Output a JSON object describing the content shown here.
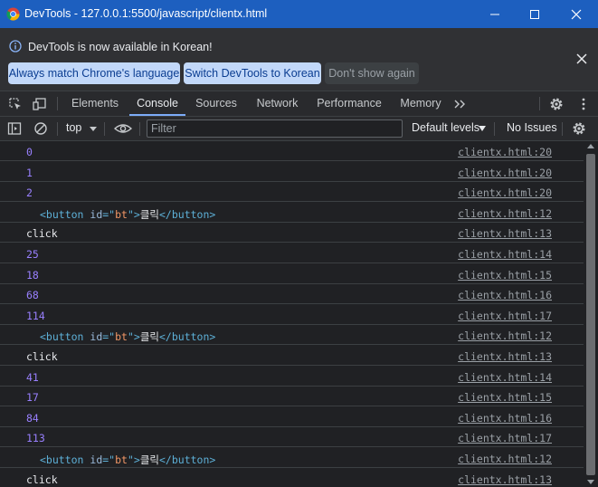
{
  "window": {
    "title": "DevTools - 127.0.0.1:5500/javascript/clientx.html"
  },
  "infobar": {
    "message": "DevTools is now available in Korean!",
    "buttons": [
      "Always match Chrome's language",
      "Switch DevTools to Korean",
      "Don't show again"
    ]
  },
  "tabs": [
    "Elements",
    "Console",
    "Sources",
    "Network",
    "Performance",
    "Memory"
  ],
  "active_tab": "Console",
  "console_toolbar": {
    "context": "top",
    "filter_placeholder": "Filter",
    "levels": "Default levels",
    "issues": "No Issues"
  },
  "logs": [
    {
      "kind": "num",
      "text": "0",
      "source": "clientx.html:20"
    },
    {
      "kind": "num",
      "text": "1",
      "source": "clientx.html:20"
    },
    {
      "kind": "num",
      "text": "2",
      "source": "clientx.html:20"
    },
    {
      "kind": "el",
      "tag_open": "<button ",
      "attr": "id",
      "eq": "=\"",
      "val": "bt",
      "close": "\">",
      "text": "클릭",
      "tag_close": "</button>",
      "source": "clientx.html:12"
    },
    {
      "kind": "str",
      "text": "click",
      "source": "clientx.html:13"
    },
    {
      "kind": "num",
      "text": "25",
      "source": "clientx.html:14"
    },
    {
      "kind": "num",
      "text": "18",
      "source": "clientx.html:15"
    },
    {
      "kind": "num",
      "text": "68",
      "source": "clientx.html:16"
    },
    {
      "kind": "num",
      "text": "114",
      "source": "clientx.html:17"
    },
    {
      "kind": "el",
      "tag_open": "<button ",
      "attr": "id",
      "eq": "=\"",
      "val": "bt",
      "close": "\">",
      "text": "클릭",
      "tag_close": "</button>",
      "source": "clientx.html:12"
    },
    {
      "kind": "str",
      "text": "click",
      "source": "clientx.html:13"
    },
    {
      "kind": "num",
      "text": "41",
      "source": "clientx.html:14"
    },
    {
      "kind": "num",
      "text": "17",
      "source": "clientx.html:15"
    },
    {
      "kind": "num",
      "text": "84",
      "source": "clientx.html:16"
    },
    {
      "kind": "num",
      "text": "113",
      "source": "clientx.html:17"
    },
    {
      "kind": "el",
      "tag_open": "<button ",
      "attr": "id",
      "eq": "=\"",
      "val": "bt",
      "close": "\">",
      "text": "클릭",
      "tag_close": "</button>",
      "source": "clientx.html:12"
    },
    {
      "kind": "str",
      "text": "click",
      "source": "clientx.html:13"
    }
  ],
  "colors": {
    "titlebar": "#1d5fbf",
    "active_tab_underline": "#7cacf8",
    "number_log": "#9980ff",
    "element_tag": "#5db0d7",
    "attr_value": "#f29766"
  },
  "icons": [
    "chrome-logo-icon",
    "minimize-icon",
    "maximize-icon",
    "close-icon",
    "info-icon",
    "inspect-element-icon",
    "device-toolbar-icon",
    "more-tabs-icon",
    "settings-icon",
    "more-options-icon",
    "sidebar-toggle-icon",
    "clear-console-icon",
    "eye-icon"
  ]
}
